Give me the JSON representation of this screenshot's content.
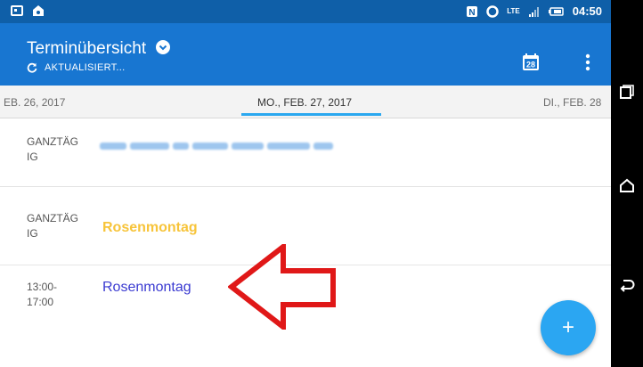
{
  "status_bar": {
    "time": "04:50",
    "network": "LTE"
  },
  "app_bar": {
    "title": "Terminübersicht",
    "subtitle": "AKTUALISIERT...",
    "calendar_day": "28"
  },
  "date_strip": {
    "previous": "EB. 26, 2017",
    "current": "MO., FEB. 27, 2017",
    "next": "DI., FEB. 28"
  },
  "events": [
    {
      "time": "GANZTÄGIG",
      "title": "",
      "title_color": "#9ec6ee"
    },
    {
      "time": "GANZTÄGIG",
      "title": "Rosenmontag",
      "title_color": "#f7c43a"
    },
    {
      "time": "13:00-17:00",
      "title": "Rosenmontag",
      "title_color": "#3a3ad1"
    }
  ],
  "fab": {
    "label": "+"
  },
  "colors": {
    "status_bar": "#0f5fa8",
    "app_bar": "#1876d1",
    "accent": "#2aa8f0",
    "arrow": "#e01818"
  }
}
